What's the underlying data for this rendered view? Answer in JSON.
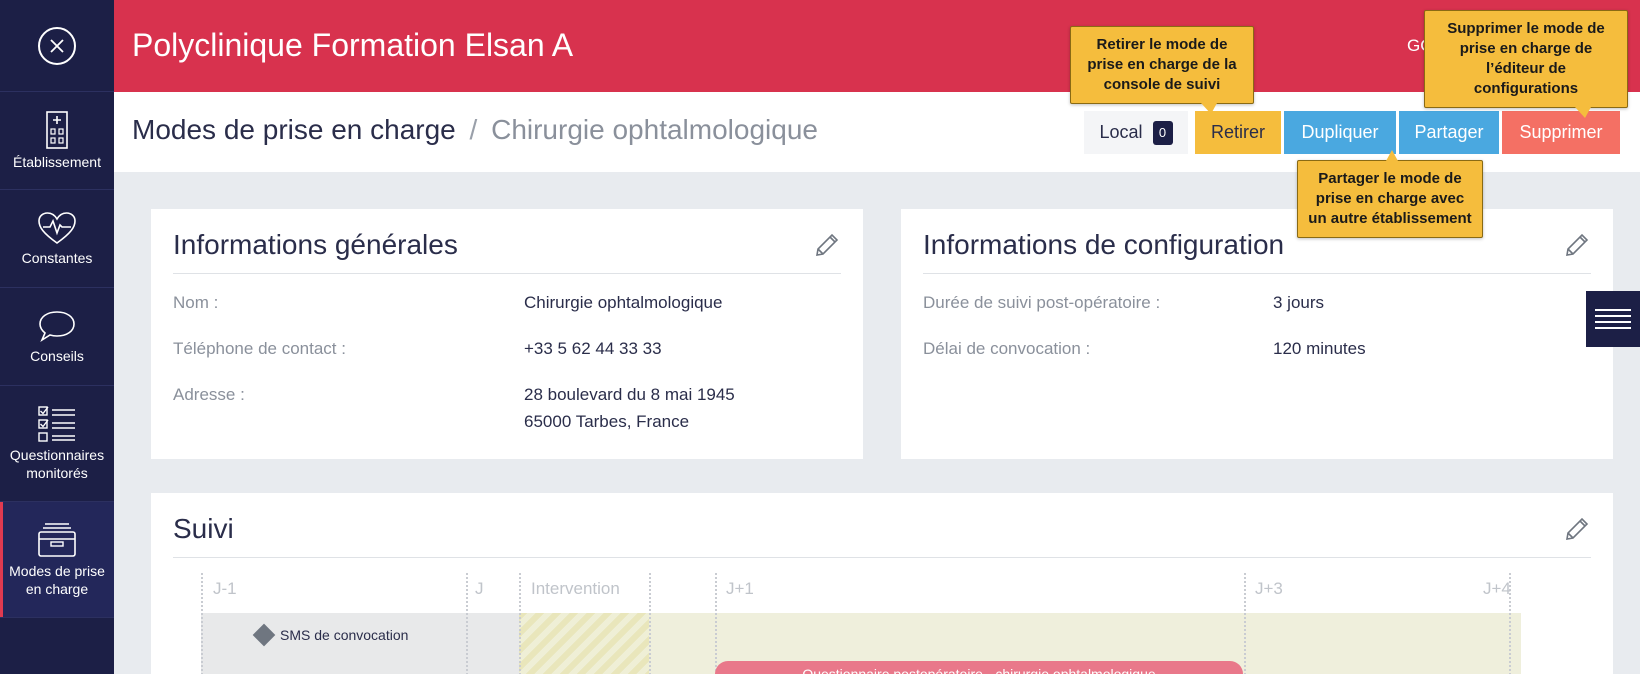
{
  "app": {
    "title": "Polyclinique Formation Elsan A",
    "user_initials": "GC"
  },
  "sidebar": {
    "items": [
      {
        "label": "Établissement",
        "icon": "hospital-icon"
      },
      {
        "label": "Constantes",
        "icon": "heart-pulse-icon"
      },
      {
        "label": "Conseils",
        "icon": "speech-bubble-icon"
      },
      {
        "label": "Questionnaires monitorés",
        "icon": "checklist-icon"
      },
      {
        "label": "Modes de prise en charge",
        "icon": "archive-box-icon",
        "active": true
      }
    ]
  },
  "breadcrumb": {
    "parent": "Modes de prise en charge",
    "separator": "/",
    "current": "Chirurgie ophtalmologique"
  },
  "toolbar": {
    "local_label": "Local",
    "local_count": "0",
    "retirer": "Retirer",
    "dupliquer": "Dupliquer",
    "partager": "Partager",
    "supprimer": "Supprimer"
  },
  "tooltips": {
    "retirer": "Retirer le mode de prise en charge de la console de suivi",
    "supprimer": "Supprimer le mode de prise en charge de l’éditeur de configurations",
    "partager": "Partager le mode de prise en charge avec un autre établissement"
  },
  "general": {
    "title": "Informations générales",
    "nom_label": "Nom :",
    "nom_value": "Chirurgie ophtalmologique",
    "tel_label": "Téléphone de contact :",
    "tel_value": "+33 5 62 44 33 33",
    "adresse_label": "Adresse :",
    "adresse_line1": "28 boulevard du 8 mai 1945",
    "adresse_line2": "65000 Tarbes, France"
  },
  "config": {
    "title": "Informations de configuration",
    "duree_label": "Durée de suivi post-opératoire :",
    "duree_value": "3 jours",
    "delai_label": "Délai de convocation :",
    "delai_value": "120 minutes"
  },
  "suivi": {
    "title": "Suivi",
    "markers": [
      "J-1",
      "J",
      "Intervention",
      "J+1",
      "J+3",
      "J+4"
    ],
    "sms_label": "SMS de convocation",
    "questionnaire_label": "Questionnaire postopératoire - chirurgie ophtalmologique"
  },
  "colors": {
    "header": "#d8324e",
    "sidebar": "#1c1f46",
    "warning": "#f5bd3d",
    "info": "#4aa8e0",
    "danger": "#f47064"
  }
}
